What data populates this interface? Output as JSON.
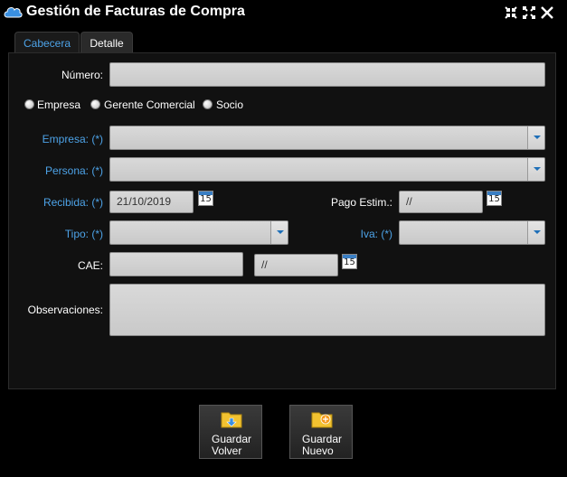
{
  "window": {
    "title": "Gestión de Facturas de Compra"
  },
  "tabs": [
    {
      "label": "Cabecera",
      "active": true
    },
    {
      "label": "Detalle",
      "active": false
    }
  ],
  "form": {
    "numero_label": "Número:",
    "numero_value": "",
    "radio_options": [
      "Empresa",
      "Gerente Comercial",
      "Socio"
    ],
    "empresa_label": "Empresa: (*)",
    "empresa_value": "",
    "persona_label": "Persona: (*)",
    "persona_value": "",
    "recibida_label": "Recibida: (*)",
    "recibida_value": "21/10/2019",
    "pago_label": "Pago Estim.:",
    "pago_value": "//",
    "tipo_label": "Tipo: (*)",
    "tipo_value": "",
    "iva_label": "Iva: (*)",
    "iva_value": "",
    "cae_label": "CAE:",
    "cae_value": "",
    "cae_date_value": "//",
    "obs_label": "Observaciones:",
    "obs_value": "",
    "calendar_day": "15"
  },
  "buttons": {
    "guardar_volver": "Guardar\nVolver",
    "guardar_nuevo": "Guardar\nNuevo"
  },
  "colors": {
    "accent_blue": "#4da3e8",
    "field_gray": "#d0d0d0",
    "background": "#000000"
  },
  "icons": [
    "cloud-icon",
    "minimize-icon",
    "maximize-icon",
    "close-icon",
    "calendar-icon",
    "folder-return-icon",
    "folder-new-icon"
  ]
}
